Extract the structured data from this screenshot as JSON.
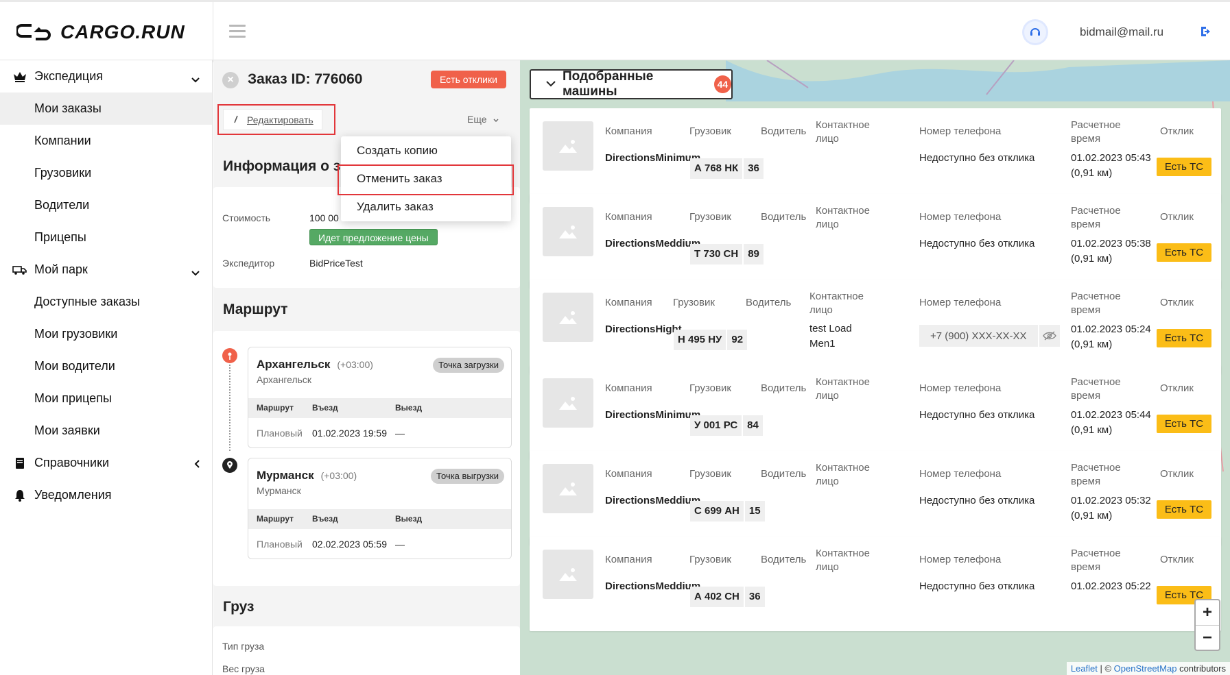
{
  "app": {
    "logo_text": "CARGO.RUN",
    "user_email": "bidmail@mail.ru"
  },
  "sidebar": {
    "items": [
      {
        "label": "Экспедиция",
        "type": "group",
        "icon": "crown-icon",
        "chevron": "down"
      },
      {
        "label": "Мои заказы",
        "type": "sub",
        "active": true
      },
      {
        "label": "Компании",
        "type": "sub"
      },
      {
        "label": "Грузовики",
        "type": "sub"
      },
      {
        "label": "Водители",
        "type": "sub"
      },
      {
        "label": "Прицепы",
        "type": "sub"
      },
      {
        "label": "Мой парк",
        "type": "group",
        "icon": "truck-icon",
        "chevron": "down"
      },
      {
        "label": "Доступные заказы",
        "type": "sub"
      },
      {
        "label": "Мои грузовики",
        "type": "sub"
      },
      {
        "label": "Мои водители",
        "type": "sub"
      },
      {
        "label": "Мои прицепы",
        "type": "sub"
      },
      {
        "label": "Мои заявки",
        "type": "sub"
      },
      {
        "label": "Справочники",
        "type": "group",
        "icon": "book-icon",
        "chevron": "left"
      },
      {
        "label": "Уведомления",
        "type": "group",
        "icon": "bell-icon"
      }
    ]
  },
  "order": {
    "title": "Заказ ID: 776060",
    "responses_badge": "Есть отклики",
    "edit_label": "Редактировать",
    "more_label": "Еще",
    "dropdown": [
      "Создать копию",
      "Отменить заказ",
      "Удалить заказ"
    ],
    "info_title": "Информация о з",
    "info": {
      "cost_label": "Стоимость",
      "cost_value": "100 00",
      "price_status": "Идет предложение цены",
      "forwarder_label": "Экспедитор",
      "forwarder_value": "BidPriceTest"
    },
    "route_title": "Маршрут",
    "stops": [
      {
        "city": "Архангельск",
        "tz": "(+03:00)",
        "sub": "Архангельск",
        "tag": "Точка загрузки",
        "headers": [
          "Маршрут",
          "Въезд",
          "Выезд"
        ],
        "row": [
          "Плановый",
          "01.02.2023 19:59",
          "—"
        ]
      },
      {
        "city": "Мурманск",
        "tz": "(+03:00)",
        "sub": "Мурманск",
        "tag": "Точка выгрузки",
        "headers": [
          "Маршрут",
          "Въезд",
          "Выезд"
        ],
        "row": [
          "Плановый",
          "02.02.2023 05:59",
          "—"
        ]
      }
    ],
    "cargo_title": "Груз",
    "cargo_type_label": "Тип груза",
    "cargo_weight_label": "Вес груза"
  },
  "matched": {
    "title": "Подобранные машины",
    "count": "44",
    "labels": {
      "company": "Компания",
      "truck": "Грузовик",
      "driver": "Водитель",
      "contact": "Контактное лицо",
      "phone": "Номер телефона",
      "eta": "Расчетное время",
      "response": "Отклик"
    },
    "cards": [
      {
        "company": "DirectionsMinimum",
        "plate": "А 768 НК",
        "region": "36",
        "contact": "",
        "phone": "Недоступно без отклика",
        "phone_masked": false,
        "eta": "01.02.2023 05:43",
        "distance": "(0,91 км)",
        "response": "Есть ТС"
      },
      {
        "company": "DirectionsMeddium",
        "plate": "Т 730 СН",
        "region": "89",
        "contact": "",
        "phone": "Недоступно без отклика",
        "phone_masked": false,
        "eta": "01.02.2023 05:38",
        "distance": "(0,91 км)",
        "response": "Есть ТС"
      },
      {
        "company": "DirectionsHight",
        "plate": "Н 495 НУ",
        "region": "92",
        "contact": "test Load Men1",
        "phone": "+7 (900) XXX-XX-XX",
        "phone_masked": true,
        "eta": "01.02.2023 05:24",
        "distance": "(0,91 км)",
        "response": "Есть ТС"
      },
      {
        "company": "DirectionsMinimum",
        "plate": "У 001 РС",
        "region": "84",
        "contact": "",
        "phone": "Недоступно без отклика",
        "phone_masked": false,
        "eta": "01.02.2023 05:44",
        "distance": "(0,91 км)",
        "response": "Есть ТС"
      },
      {
        "company": "DirectionsMeddium",
        "plate": "С 699 АН",
        "region": "15",
        "contact": "",
        "phone": "Недоступно без отклика",
        "phone_masked": false,
        "eta": "01.02.2023 05:32",
        "distance": "(0,91 км)",
        "response": "Есть ТС"
      },
      {
        "company": "DirectionsMeddium",
        "plate": "А 402 СН",
        "region": "36",
        "contact": "",
        "phone": "Недоступно без отклика",
        "phone_masked": false,
        "eta": "01.02.2023 05:22",
        "distance": "",
        "response": "Есть ТС"
      }
    ]
  },
  "map": {
    "zoom_in": "+",
    "zoom_out": "−",
    "attribution_leaflet": "Leaflet",
    "attribution_sep": " | © ",
    "attribution_osm": "OpenStreetMap",
    "attribution_tail": " contributors"
  },
  "colors": {
    "accent_red": "#f0614a",
    "yellow": "#fbbd17",
    "green": "#55a964",
    "highlight": "#e2363a"
  }
}
